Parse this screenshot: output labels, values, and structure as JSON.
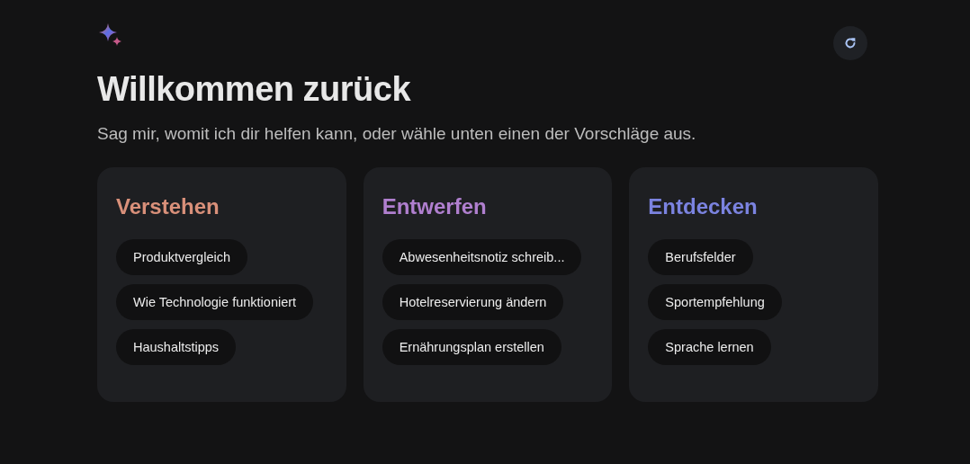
{
  "title": "Willkommen zurück",
  "subtitle": "Sag mir, womit ich dir helfen kann, oder wähle unten einen der Vorschläge aus.",
  "cards": [
    {
      "heading": "Verstehen",
      "color": "#d9907a",
      "suggestions": [
        "Produktvergleich",
        "Wie Technologie funktioniert",
        "Haushaltstipps"
      ]
    },
    {
      "heading": "Entwerfen",
      "color": "#b07fcf",
      "suggestions": [
        "Abwesenheitsnotiz schreib...",
        "Hotelreservierung ändern",
        "Ernährungsplan erstellen"
      ]
    },
    {
      "heading": "Entdecken",
      "color": "#7b83e0",
      "suggestions": [
        "Berufsfelder",
        "Sportempfehlung",
        "Sprache lernen"
      ]
    }
  ]
}
